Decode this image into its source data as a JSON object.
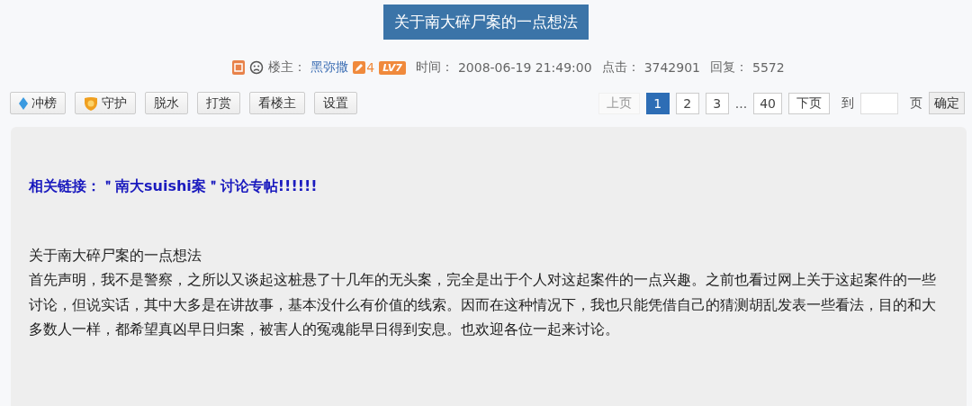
{
  "title": "关于南大碎尸案的一点想法",
  "meta": {
    "author_label": "楼主：",
    "author": "黑弥撒",
    "post_count": "4",
    "level": "LV7",
    "time_label": "时间：",
    "time": "2008-06-19 21:49:00",
    "views_label": "点击：",
    "views": "3742901",
    "replies_label": "回复：",
    "replies": "5572"
  },
  "actions": [
    {
      "label": "冲榜",
      "kind": "diamond"
    },
    {
      "label": "守护",
      "kind": "shield"
    },
    {
      "label": "脱水",
      "kind": "plain"
    },
    {
      "label": "打赏",
      "kind": "plain"
    },
    {
      "label": "看楼主",
      "kind": "plain"
    },
    {
      "label": "设置",
      "kind": "plain"
    }
  ],
  "pagination": {
    "prev": {
      "label": "上页",
      "disabled": true
    },
    "pages": [
      {
        "label": "1",
        "selected": true
      },
      {
        "label": "2",
        "selected": false
      },
      {
        "label": "3",
        "selected": false
      },
      {
        "label": "...",
        "kind": "ellipsis"
      },
      {
        "label": "40",
        "selected": false
      }
    ],
    "next": {
      "label": "下页",
      "disabled": false
    },
    "goto_label": "到",
    "page_label": "页",
    "confirm": "确定"
  },
  "post": {
    "link": "相关链接：＂南大suishi案＂讨论专帖!!!!!!",
    "heading": "关于南大碎尸案的一点想法",
    "body": "首先声明，我不是警察，之所以又谈起这桩悬了十几年的无头案，完全是出于个人对这起案件的一点兴趣。之前也看过网上关于这起案件的一些讨论，但说实话，其中大多是在讲故事，基本没什么有价值的线索。因而在这种情况下，我也只能凭借自己的猜测胡乱发表一些看法，目的和大多数人一样，都希望真凶早日归案，被害人的冤魂能早日得到安息。也欢迎各位一起来讨论。"
  }
}
